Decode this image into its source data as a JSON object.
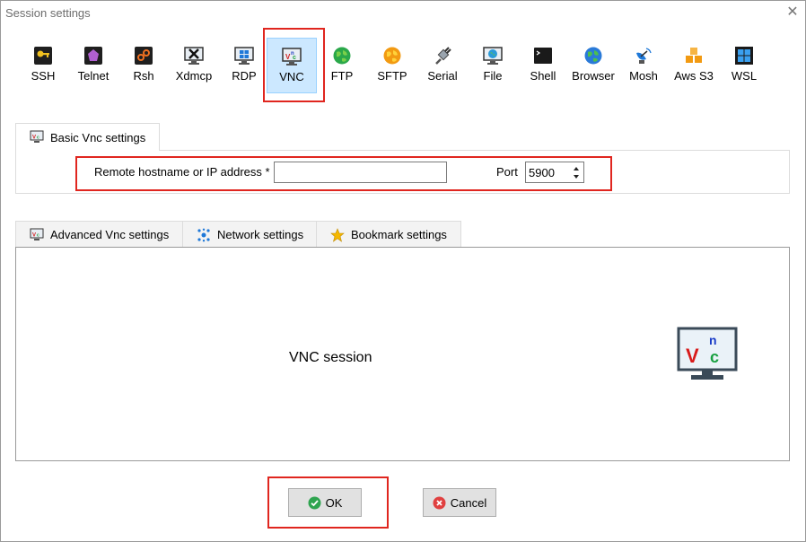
{
  "window": {
    "title": "Session settings",
    "close_glyph": "✕"
  },
  "protocols": [
    {
      "label": "SSH",
      "icon": "key-icon"
    },
    {
      "label": "Telnet",
      "icon": "telnet-icon"
    },
    {
      "label": "Rsh",
      "icon": "rsh-icon"
    },
    {
      "label": "Xdmcp",
      "icon": "xdmcp-icon"
    },
    {
      "label": "RDP",
      "icon": "rdp-icon"
    },
    {
      "label": "VNC",
      "icon": "vnc-icon",
      "selected": true
    },
    {
      "label": "FTP",
      "icon": "ftp-globe-icon"
    },
    {
      "label": "SFTP",
      "icon": "sftp-globe-icon"
    },
    {
      "label": "Serial",
      "icon": "serial-plug-icon"
    },
    {
      "label": "File",
      "icon": "file-monitor-icon"
    },
    {
      "label": "Shell",
      "icon": "shell-terminal-icon"
    },
    {
      "label": "Browser",
      "icon": "browser-globe-icon"
    },
    {
      "label": "Mosh",
      "icon": "satellite-dish-icon"
    },
    {
      "label": "Aws S3",
      "icon": "aws-cubes-icon"
    },
    {
      "label": "WSL",
      "icon": "windows-logo-icon"
    }
  ],
  "basic": {
    "tab_label": "Basic Vnc settings",
    "host_label": "Remote hostname or IP address *",
    "host_value": "",
    "port_label": "Port",
    "port_value": "5900"
  },
  "advanced_tabs": [
    {
      "label": "Advanced Vnc settings",
      "icon": "vnc-icon"
    },
    {
      "label": "Network settings",
      "icon": "network-icon"
    },
    {
      "label": "Bookmark settings",
      "icon": "star-icon"
    }
  ],
  "session_label": "VNC session",
  "buttons": {
    "ok": "OK",
    "cancel": "Cancel"
  },
  "colors": {
    "highlight": "#e0261f",
    "selected_bg": "#cce8ff",
    "ok_green": "#2ea44f",
    "cancel_red": "#e04040"
  }
}
